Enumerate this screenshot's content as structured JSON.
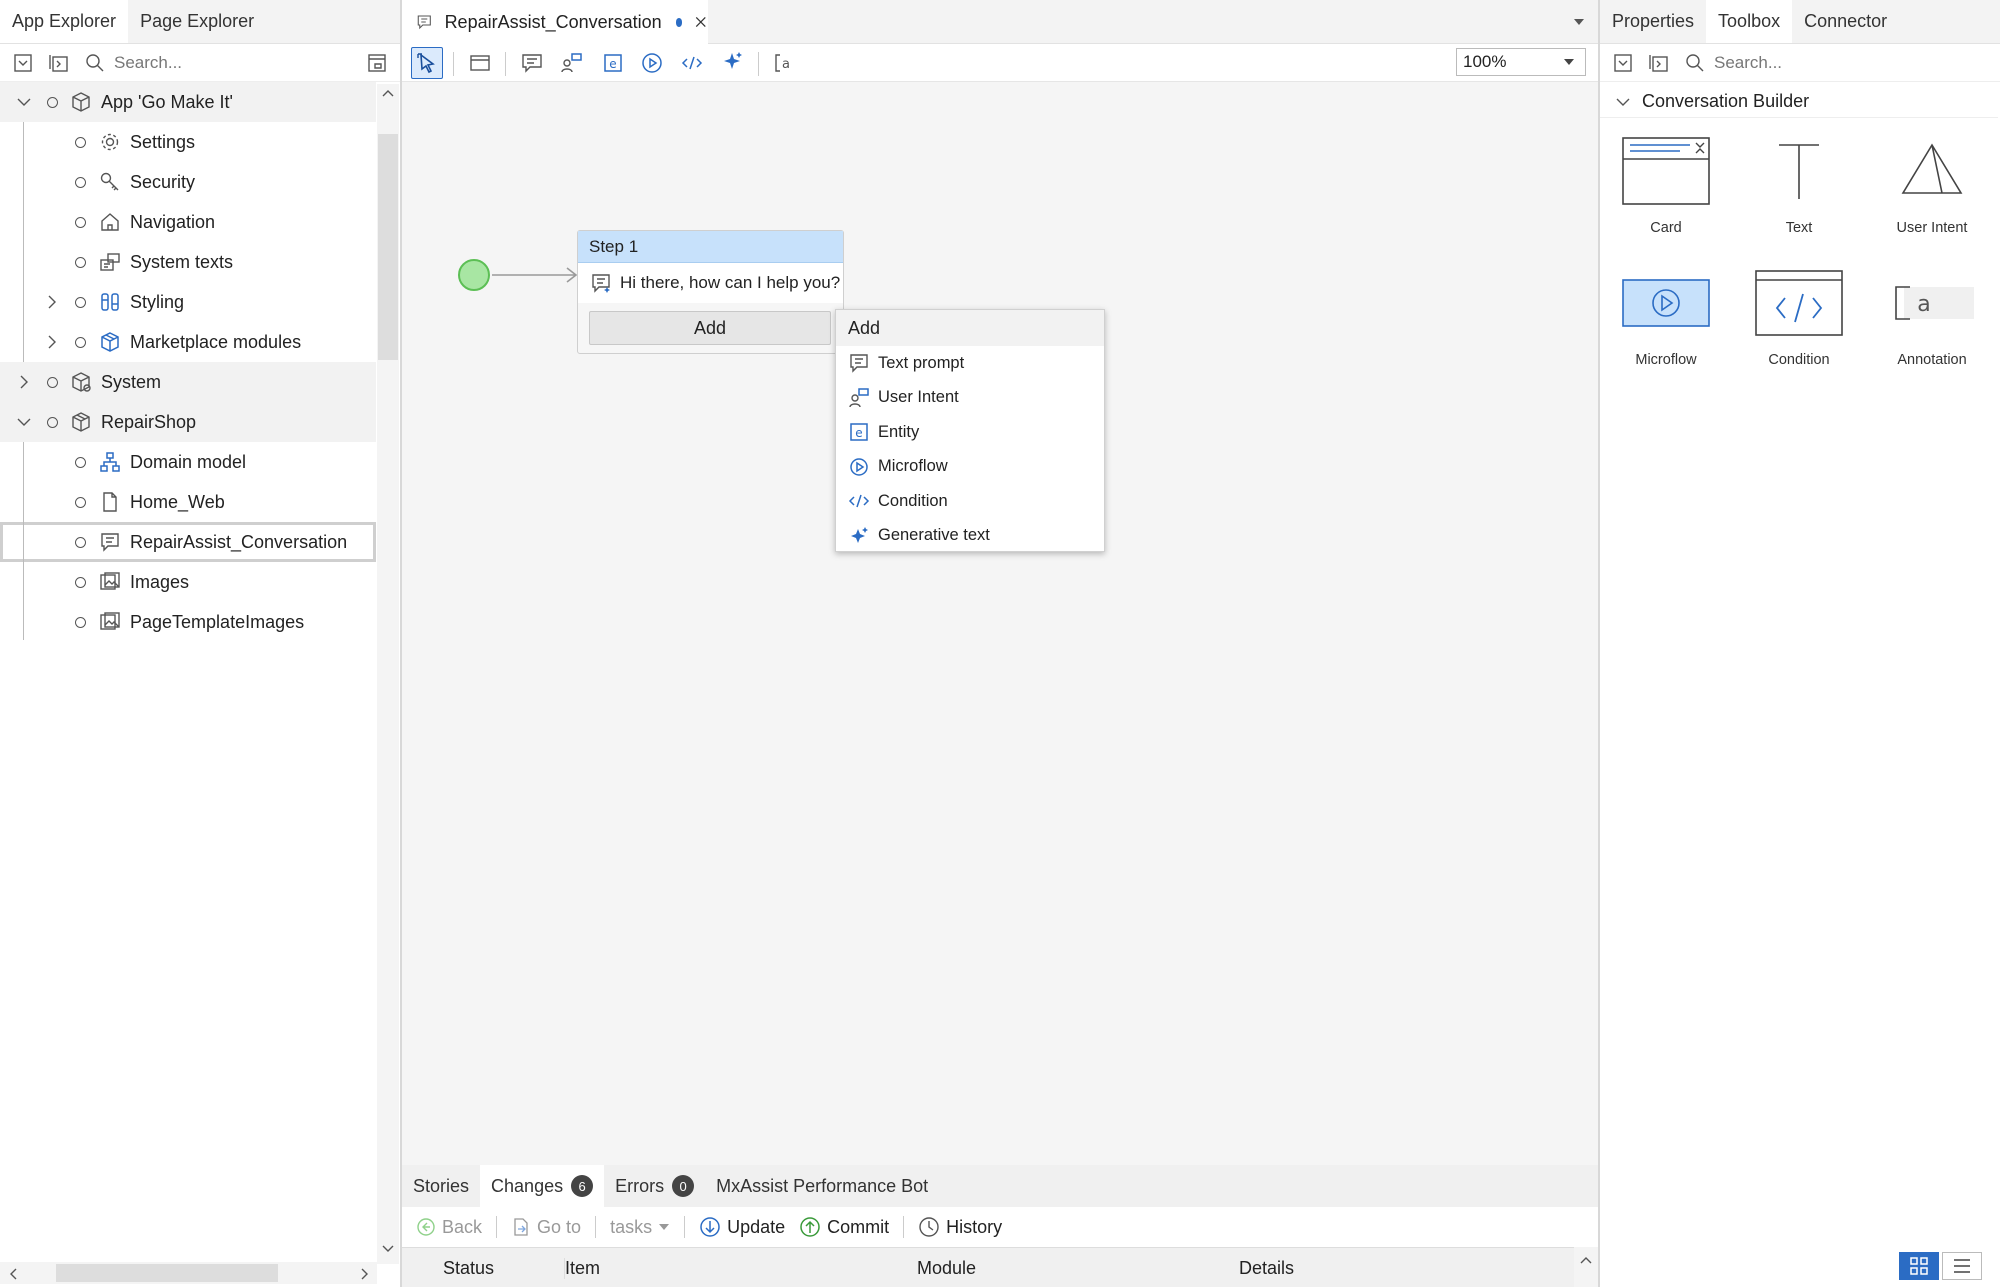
{
  "left_panel": {
    "tabs": [
      "App Explorer",
      "Page Explorer"
    ],
    "search_placeholder": "Search...",
    "tree": [
      {
        "label": "App 'Go Make It'",
        "icon": "cube-icon"
      },
      {
        "label": "Settings",
        "icon": "gear-icon"
      },
      {
        "label": "Security",
        "icon": "key-icon"
      },
      {
        "label": "Navigation",
        "icon": "home-icon"
      },
      {
        "label": "System texts",
        "icon": "system-texts-icon"
      },
      {
        "label": "Styling",
        "icon": "styling-icon"
      },
      {
        "label": "Marketplace modules",
        "icon": "marketplace-icon"
      },
      {
        "label": "System",
        "icon": "module-icon"
      },
      {
        "label": "RepairShop",
        "icon": "module-icon"
      },
      {
        "label": "Domain model",
        "icon": "domain-model-icon"
      },
      {
        "label": "Home_Web",
        "icon": "page-icon"
      },
      {
        "label": "RepairAssist_Conversation",
        "icon": "conversation-icon"
      },
      {
        "label": "Images",
        "icon": "image-icon"
      },
      {
        "label": "PageTemplateImages",
        "icon": "image-icon"
      }
    ]
  },
  "editor": {
    "tab_title": "RepairAssist_Conversation",
    "zoom": "100%",
    "step": {
      "title": "Step 1",
      "message": "Hi there, how can I help you?",
      "add_label": "Add"
    },
    "context_menu": {
      "header": "Add",
      "items": [
        "Text prompt",
        "User Intent",
        "Entity",
        "Microflow",
        "Condition",
        "Generative text"
      ]
    }
  },
  "bottom_panel": {
    "tabs": [
      {
        "label": "Stories"
      },
      {
        "label": "Changes",
        "badge": "6"
      },
      {
        "label": "Errors",
        "badge": "0"
      },
      {
        "label": "MxAssist Performance Bot"
      }
    ],
    "toolbar": {
      "back": "Back",
      "goto": "Go to",
      "tasks": "tasks",
      "update": "Update",
      "commit": "Commit",
      "history": "History"
    },
    "columns": [
      "Status",
      "Item",
      "Module",
      "Details"
    ]
  },
  "right_panel": {
    "tabs": [
      "Properties",
      "Toolbox",
      "Connector"
    ],
    "search_placeholder": "Search...",
    "section": "Conversation Builder",
    "tools": [
      "Card",
      "Text",
      "User Intent",
      "Microflow",
      "Condition",
      "Annotation"
    ]
  },
  "colors": {
    "step_header": "#c7e1fb",
    "start_node": "#a8e6a3",
    "accent_blue": "#2b6cc4",
    "selected_tool": "#c7e1fb"
  }
}
